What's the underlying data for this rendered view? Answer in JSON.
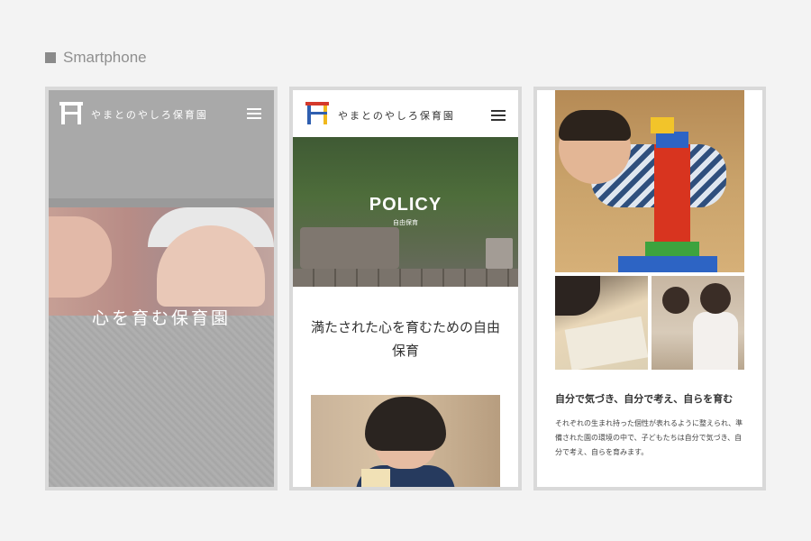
{
  "section_label": "Smartphone",
  "phone1": {
    "logo_text": "やまとのやしろ保育園",
    "headline": "心を育む保育園"
  },
  "phone2": {
    "logo_text": "やまとのやしろ保育園",
    "hero_title": "POLICY",
    "hero_subtitle": "自由保育",
    "policy_text": "満たされた心を育むための自由保育"
  },
  "phone3": {
    "heading": "自分で気づき、自分で考え、自らを育む",
    "body": "それぞれの生まれ持った個性が表れるように整えられ、準備された園の環境の中で、子どもたちは自分で気づき、自分で考え、自らを育みます。"
  },
  "colors": {
    "logo_red": "#d4392b",
    "logo_blue": "#2f5fb0",
    "logo_yellow": "#f0b81c",
    "frame": "#d9d9d9"
  }
}
